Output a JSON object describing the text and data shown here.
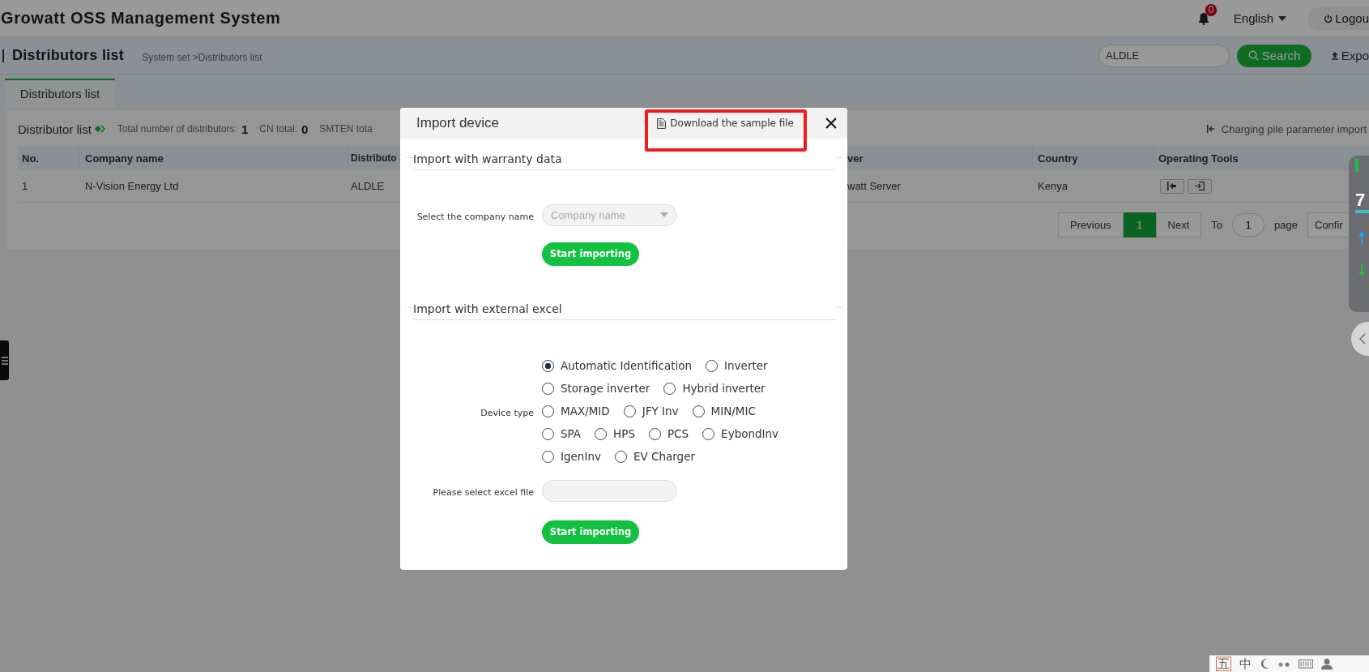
{
  "header": {
    "title": "Growatt OSS Management System",
    "notifications": "0",
    "language": "English",
    "logout": "Logou"
  },
  "page": {
    "title": "Distributors list",
    "breadcrumb": "System set >Distributors list",
    "search": {
      "value": "ALDLE"
    },
    "search_button": "Search",
    "export": "Expo"
  },
  "tabs": [
    {
      "label": "Distributors list",
      "selected": true
    }
  ],
  "list": {
    "title": "Distributor list",
    "stats": [
      {
        "label": "Total number of distributors:",
        "value": "1"
      },
      {
        "label": "CN total:",
        "value": "0"
      },
      {
        "label": "SMTEN tota"
      }
    ],
    "import_link": "Charging pile parameter import"
  },
  "table": {
    "columns": [
      "No.",
      "Company name",
      "Distributo",
      "ver",
      "Country",
      "Operating Tools"
    ],
    "rows": [
      {
        "cells": [
          "1",
          "N-Vision Energy Ltd",
          "ALDLE",
          "watt Server",
          "Kenya"
        ]
      }
    ]
  },
  "pagination": {
    "previous": "Previous",
    "pages": [
      {
        "label": "1",
        "selected": true
      }
    ],
    "next": "Next",
    "to": "To",
    "page_input": "1",
    "page": "page",
    "confirm": "Confir"
  },
  "side_widget": {
    "value": "7"
  },
  "dialog": {
    "title": "Import device",
    "download": "Download the sample file",
    "sections": [
      {
        "title": "Import with warranty data",
        "fields": [
          {
            "kind": "select",
            "label": "Select the company name",
            "placeholder": "Company name"
          },
          {
            "kind": "button",
            "label": "Start importing"
          }
        ]
      },
      {
        "title": "Import with external excel",
        "fields": [
          {
            "kind": "radios",
            "label": "Device type",
            "option_rows": [
              [
                {
                  "label": "Automatic Identification",
                  "selected": true
                },
                {
                  "label": "Inverter",
                  "selected": false
                }
              ],
              [
                {
                  "label": "Storage inverter",
                  "selected": false
                },
                {
                  "label": "Hybrid inverter",
                  "selected": false
                }
              ],
              [
                {
                  "label": "MAX/MID",
                  "selected": false
                },
                {
                  "label": "JFY Inv",
                  "selected": false
                },
                {
                  "label": "MIN/MIC",
                  "selected": false
                }
              ],
              [
                {
                  "label": "SPA",
                  "selected": false
                },
                {
                  "label": "HPS",
                  "selected": false
                },
                {
                  "label": "PCS",
                  "selected": false
                },
                {
                  "label": "EybondInv",
                  "selected": false
                }
              ],
              [
                {
                  "label": "IgenInv",
                  "selected": false
                },
                {
                  "label": "EV Charger",
                  "selected": false
                }
              ]
            ]
          },
          {
            "kind": "file",
            "label": "Please select excel file"
          },
          {
            "kind": "button",
            "label": "Start importing"
          }
        ]
      }
    ]
  },
  "annotations": [
    {
      "kind": "rectangle"
    }
  ],
  "ime_bar": {
    "items": [
      "五",
      "中"
    ]
  }
}
